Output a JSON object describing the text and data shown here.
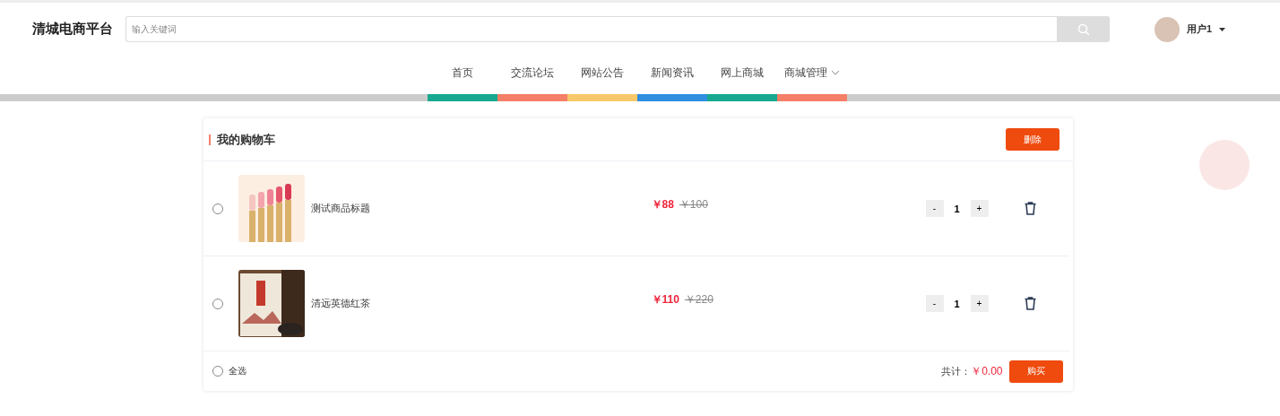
{
  "header": {
    "logo": "清城电商平台",
    "search": {
      "placeholder": "输入关键词"
    },
    "user": {
      "name": "用户1"
    }
  },
  "nav": [
    {
      "label": "首页",
      "color": "#17a88f"
    },
    {
      "label": "交流论坛",
      "color": "#f57f67"
    },
    {
      "label": "网站公告",
      "color": "#f9c86a"
    },
    {
      "label": "新闻资讯",
      "color": "#2f8ee0"
    },
    {
      "label": "网上商城",
      "color": "#17a88f"
    },
    {
      "label": "商城管理",
      "color": "#f57f67",
      "dropdown": true
    }
  ],
  "cart": {
    "title": "我的购物车",
    "delete_button": "删除",
    "items": [
      {
        "selected": false,
        "name": "测试商品标题",
        "price": "￥88",
        "original_price": "￥100",
        "quantity": "1",
        "minus": "-",
        "plus": "+"
      },
      {
        "selected": false,
        "name": "清远英德红茶",
        "price": "￥110",
        "original_price": "￥220",
        "quantity": "1",
        "minus": "-",
        "plus": "+"
      }
    ],
    "footer": {
      "select_all": {
        "label": "全选",
        "selected": false
      },
      "total_label": "共计：",
      "total": "￥0.00",
      "buy_button": "购买"
    }
  }
}
